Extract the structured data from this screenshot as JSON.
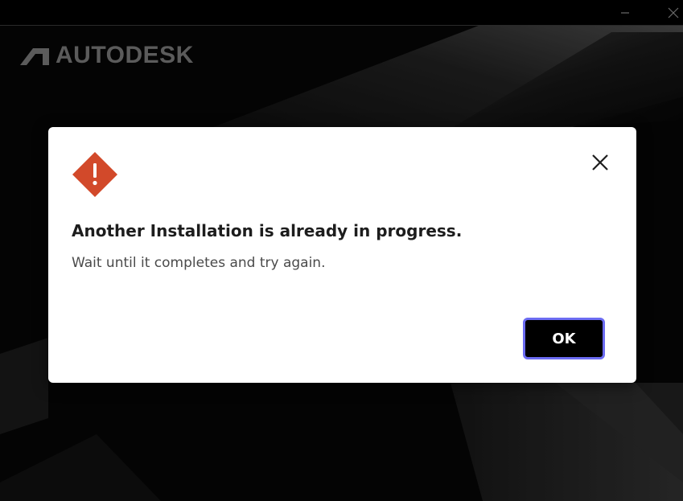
{
  "window": {
    "minimize_icon": "minimize-icon",
    "close_icon": "close-icon"
  },
  "brand": {
    "logo_icon": "autodesk-logo-icon",
    "name": "AUTODESK"
  },
  "dialog": {
    "icon": "warning-diamond-icon",
    "title": "Another Installation is already in progress.",
    "message": "Wait until it completes and try again.",
    "ok_label": "OK",
    "close_icon": "close-icon"
  },
  "colors": {
    "warning": "#d2492a",
    "button_bg": "#000000",
    "button_focus_ring": "#6c6cf2",
    "brand_text": "#7a7a7a"
  }
}
